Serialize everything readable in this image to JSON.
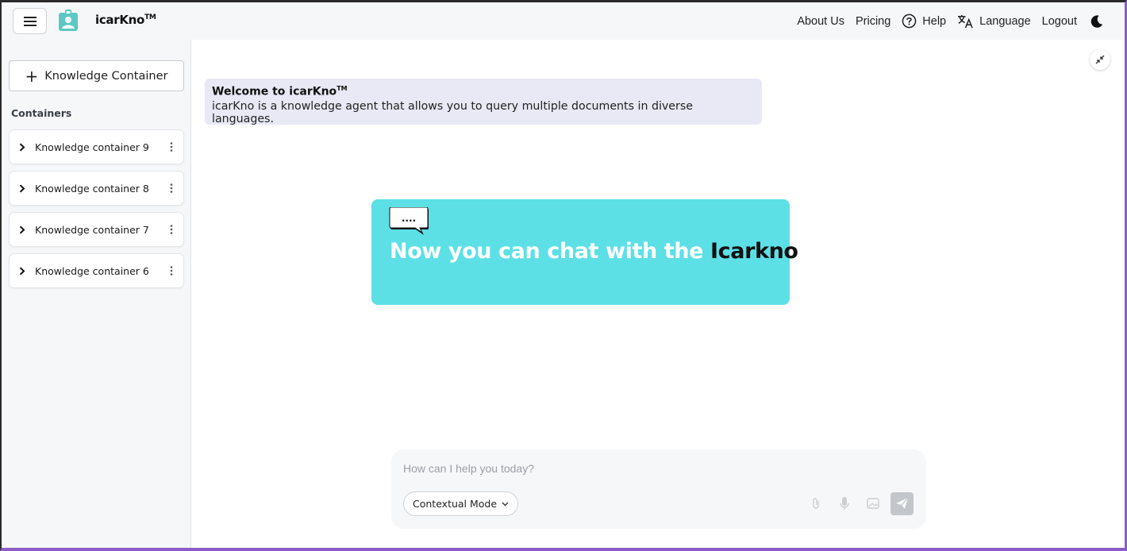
{
  "header": {
    "brand_name": "icarKno",
    "brand_tm": "TM",
    "nav": {
      "about": "About Us",
      "pricing": "Pricing",
      "help": "Help",
      "language": "Language",
      "logout": "Logout"
    }
  },
  "sidebar": {
    "new_container_label": "Knowledge Container",
    "section_title": "Containers",
    "containers": [
      {
        "label": "Knowledge container 9"
      },
      {
        "label": "Knowledge container 8"
      },
      {
        "label": "Knowledge container 7"
      },
      {
        "label": "Knowledge container 6"
      }
    ]
  },
  "main": {
    "welcome_title": "Welcome to icarKno",
    "welcome_tm": "TM",
    "welcome_text": "icarKno is a knowledge agent that allows you to query multiple documents in diverse languages.",
    "banner": {
      "bubble_text": "....",
      "text_prefix": "Now you can chat with the ",
      "text_accent": "Icarkno",
      "background": "#5ce0e6"
    },
    "chat": {
      "placeholder": "How can I help you today?",
      "mode_label": "Contextual Mode"
    }
  },
  "colors": {
    "accent": "#5ce0e6",
    "brand_icon": "#5cc8c4",
    "frame": "#8a5cc7"
  }
}
